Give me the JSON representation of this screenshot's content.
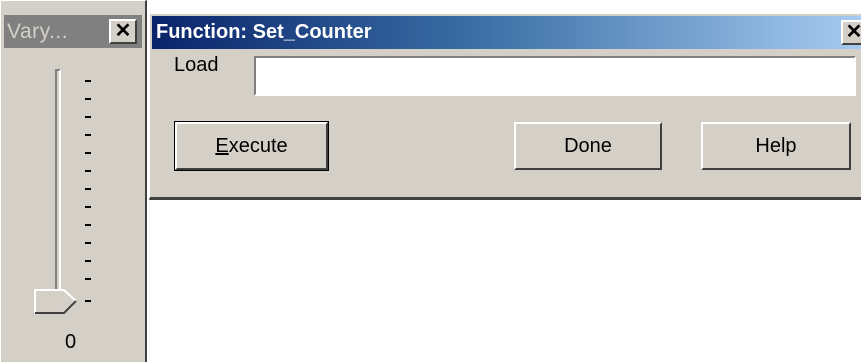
{
  "slider_window": {
    "title": "Vary...",
    "close_label": "✕",
    "value": "0",
    "level": 0
  },
  "dialog": {
    "title": "Function: Set_Counter",
    "close_label": "✕",
    "load_label": "Load",
    "load_value": "",
    "buttons": {
      "execute_mnemonic": "E",
      "execute_rest": "xecute",
      "done": "Done",
      "help": "Help"
    }
  }
}
